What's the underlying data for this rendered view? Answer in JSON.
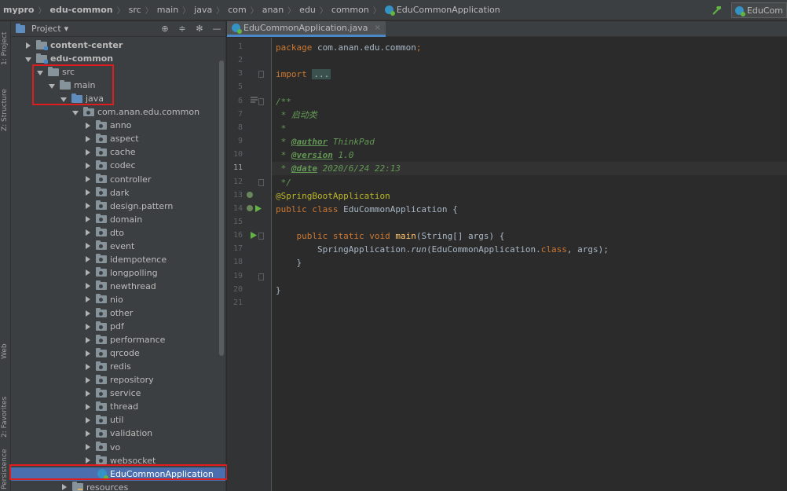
{
  "breadcrumb": [
    "mypro",
    "edu-common",
    "src",
    "main",
    "java",
    "com",
    "anan",
    "edu",
    "common",
    "EduCommonApplication"
  ],
  "run_config": "EduCom",
  "stripe": {
    "project": "1: Project",
    "structure": "Z: Structure",
    "web": "Web",
    "favorites": "2: Favorites",
    "persistence": "Persistence"
  },
  "project_panel": {
    "title": "Project",
    "dropdown_glyph": "▾"
  },
  "tree": [
    {
      "label": "content-center",
      "arrow": "right",
      "icon": "module",
      "bold": true
    },
    {
      "label": "edu-common",
      "arrow": "down",
      "icon": "module",
      "bold": true
    },
    {
      "label": "src",
      "arrow": "down",
      "icon": "plain"
    },
    {
      "label": "main",
      "arrow": "down",
      "icon": "plain"
    },
    {
      "label": "java",
      "arrow": "down",
      "icon": "src"
    },
    {
      "label": "com.anan.edu.common",
      "arrow": "down",
      "icon": "pkg"
    },
    {
      "label": "anno",
      "arrow": "right",
      "icon": "pkg"
    },
    {
      "label": "aspect",
      "arrow": "right",
      "icon": "pkg"
    },
    {
      "label": "cache",
      "arrow": "right",
      "icon": "pkg"
    },
    {
      "label": "codec",
      "arrow": "right",
      "icon": "pkg"
    },
    {
      "label": "controller",
      "arrow": "right",
      "icon": "pkg"
    },
    {
      "label": "dark",
      "arrow": "right",
      "icon": "pkg"
    },
    {
      "label": "design.pattern",
      "arrow": "right",
      "icon": "pkg"
    },
    {
      "label": "domain",
      "arrow": "right",
      "icon": "pkg"
    },
    {
      "label": "dto",
      "arrow": "right",
      "icon": "pkg"
    },
    {
      "label": "event",
      "arrow": "right",
      "icon": "pkg"
    },
    {
      "label": "idempotence",
      "arrow": "right",
      "icon": "pkg"
    },
    {
      "label": "longpolling",
      "arrow": "right",
      "icon": "pkg"
    },
    {
      "label": "newthread",
      "arrow": "right",
      "icon": "pkg"
    },
    {
      "label": "nio",
      "arrow": "right",
      "icon": "pkg"
    },
    {
      "label": "other",
      "arrow": "right",
      "icon": "pkg"
    },
    {
      "label": "pdf",
      "arrow": "right",
      "icon": "pkg"
    },
    {
      "label": "performance",
      "arrow": "right",
      "icon": "pkg"
    },
    {
      "label": "qrcode",
      "arrow": "right",
      "icon": "pkg"
    },
    {
      "label": "redis",
      "arrow": "right",
      "icon": "pkg"
    },
    {
      "label": "repository",
      "arrow": "right",
      "icon": "pkg"
    },
    {
      "label": "service",
      "arrow": "right",
      "icon": "pkg"
    },
    {
      "label": "thread",
      "arrow": "right",
      "icon": "pkg"
    },
    {
      "label": "util",
      "arrow": "right",
      "icon": "pkg"
    },
    {
      "label": "validation",
      "arrow": "right",
      "icon": "pkg"
    },
    {
      "label": "vo",
      "arrow": "right",
      "icon": "pkg"
    },
    {
      "label": "websocket",
      "arrow": "right",
      "icon": "pkg"
    },
    {
      "label": "EduCommonApplication",
      "arrow": "none",
      "icon": "class",
      "selected": true
    },
    {
      "label": "resources",
      "arrow": "right",
      "icon": "res"
    }
  ],
  "editor": {
    "tab_label": "EduCommonApplication.java",
    "tab_close": "×",
    "current_line": 11,
    "lines": [
      {
        "n": "1",
        "parts": [
          {
            "t": "package ",
            "c": "kw"
          },
          {
            "t": "com.anan.edu.common",
            "c": "cn"
          },
          {
            "t": ";",
            "c": "kw"
          }
        ]
      },
      {
        "n": "2",
        "parts": []
      },
      {
        "n": "3",
        "parts": [
          {
            "t": "import ",
            "c": "kw"
          },
          {
            "t": "...",
            "c": "fold"
          }
        ]
      },
      {
        "n": "5",
        "parts": []
      },
      {
        "n": "6",
        "parts": [
          {
            "t": "/**",
            "c": "cm"
          }
        ]
      },
      {
        "n": "7",
        "parts": [
          {
            "t": " * 启动类",
            "c": "cm"
          }
        ]
      },
      {
        "n": "8",
        "parts": [
          {
            "t": " *",
            "c": "cm"
          }
        ]
      },
      {
        "n": "9",
        "parts": [
          {
            "t": " * ",
            "c": "cm"
          },
          {
            "t": "@author",
            "c": "tag"
          },
          {
            "t": " ThinkPad",
            "c": "cm"
          }
        ]
      },
      {
        "n": "10",
        "parts": [
          {
            "t": " * ",
            "c": "cm"
          },
          {
            "t": "@version",
            "c": "tag"
          },
          {
            "t": " 1.0",
            "c": "cm"
          }
        ]
      },
      {
        "n": "11",
        "parts": [
          {
            "t": " * ",
            "c": "cm"
          },
          {
            "t": "@date",
            "c": "tag"
          },
          {
            "t": " 2020/6/24 22:13",
            "c": "cm"
          }
        ]
      },
      {
        "n": "12",
        "parts": [
          {
            "t": " */",
            "c": "cm"
          }
        ]
      },
      {
        "n": "13",
        "parts": [
          {
            "t": "@SpringBootApplication",
            "c": "ann"
          }
        ]
      },
      {
        "n": "14",
        "parts": [
          {
            "t": "public class ",
            "c": "kw"
          },
          {
            "t": "EduCommonApplication {",
            "c": "cn"
          }
        ]
      },
      {
        "n": "15",
        "parts": []
      },
      {
        "n": "16",
        "parts": [
          {
            "t": "    public static void ",
            "c": "kw"
          },
          {
            "t": "main",
            "c": "fn"
          },
          {
            "t": "(String[] args) {",
            "c": "cn"
          }
        ]
      },
      {
        "n": "17",
        "parts": [
          {
            "t": "        SpringApplication.",
            "c": "cn"
          },
          {
            "t": "run",
            "c": "it"
          },
          {
            "t": "(EduCommonApplication.",
            "c": "cn"
          },
          {
            "t": "class",
            "c": "kw"
          },
          {
            "t": ", args);",
            "c": "cn"
          }
        ]
      },
      {
        "n": "18",
        "parts": [
          {
            "t": "    }",
            "c": "cn"
          }
        ]
      },
      {
        "n": "19",
        "parts": []
      },
      {
        "n": "20",
        "parts": [
          {
            "t": "}",
            "c": "cn"
          }
        ]
      },
      {
        "n": "21",
        "parts": []
      }
    ]
  },
  "colors": {
    "highlight_box": "#e01c1c",
    "selection": "#4b6eaf",
    "background": "#2b2b2b",
    "panel": "#3c3f41"
  }
}
